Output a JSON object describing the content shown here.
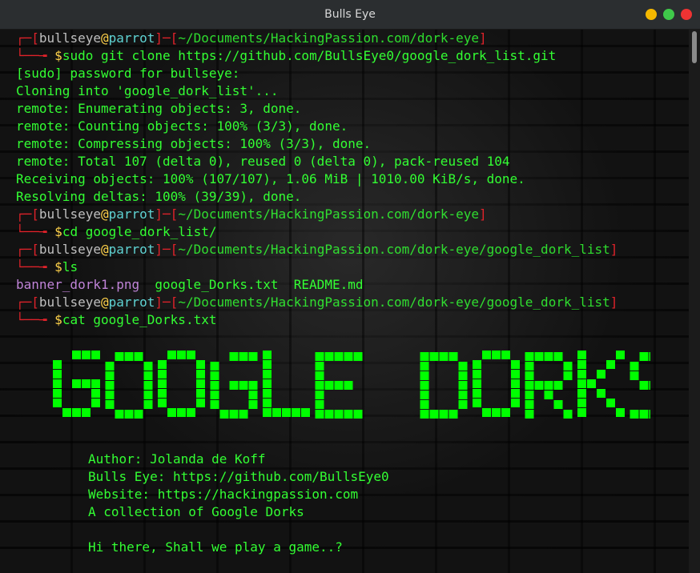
{
  "window": {
    "title": "Bulls Eye"
  },
  "prompt": {
    "user": "bullseye",
    "at": "@",
    "host": "parrot",
    "dollar": "$"
  },
  "lines": [
    {
      "kind": "prompt",
      "path": "~/Documents/HackingPassion.com/dork-eye",
      "cmd": "sudo git clone https://github.com/BullsEye0/google_dork_list.git"
    },
    {
      "kind": "out",
      "text": "[sudo] password for bullseye:"
    },
    {
      "kind": "out",
      "text": "Cloning into 'google_dork_list'..."
    },
    {
      "kind": "out",
      "text": "remote: Enumerating objects: 3, done."
    },
    {
      "kind": "out",
      "text": "remote: Counting objects: 100% (3/3), done."
    },
    {
      "kind": "out",
      "text": "remote: Compressing objects: 100% (3/3), done."
    },
    {
      "kind": "out",
      "text": "remote: Total 107 (delta 0), reused 0 (delta 0), pack-reused 104"
    },
    {
      "kind": "out",
      "text": "Receiving objects: 100% (107/107), 1.06 MiB | 1010.00 KiB/s, done."
    },
    {
      "kind": "out",
      "text": "Resolving deltas: 100% (39/39), done."
    },
    {
      "kind": "prompt",
      "path": "~/Documents/HackingPassion.com/dork-eye",
      "cmd": "cd google_dork_list/"
    },
    {
      "kind": "prompt",
      "path": "~/Documents/HackingPassion.com/dork-eye/google_dork_list",
      "cmd": "ls"
    },
    {
      "kind": "ls",
      "files": [
        "banner_dork1.png",
        "google_Dorks.txt",
        "README.md"
      ]
    },
    {
      "kind": "prompt",
      "path": "~/Documents/HackingPassion.com/dork-eye/google_dork_list",
      "cmd": "cat google_Dorks.txt"
    }
  ],
  "banner": {
    "text": "GOOGLE DORKS",
    "color": "#00ff00"
  },
  "info": [
    "Author: Jolanda de Koff",
    "Bulls Eye: https://github.com/BullsEye0",
    "Website: https://hackingpassion.com",
    "A collection of Google Dorks",
    "",
    "Hi there, Shall we play a game..?"
  ],
  "colors": {
    "accent": "#33ff33",
    "prompt_bracket": "#e0222a",
    "host": "#5fd3d3"
  }
}
